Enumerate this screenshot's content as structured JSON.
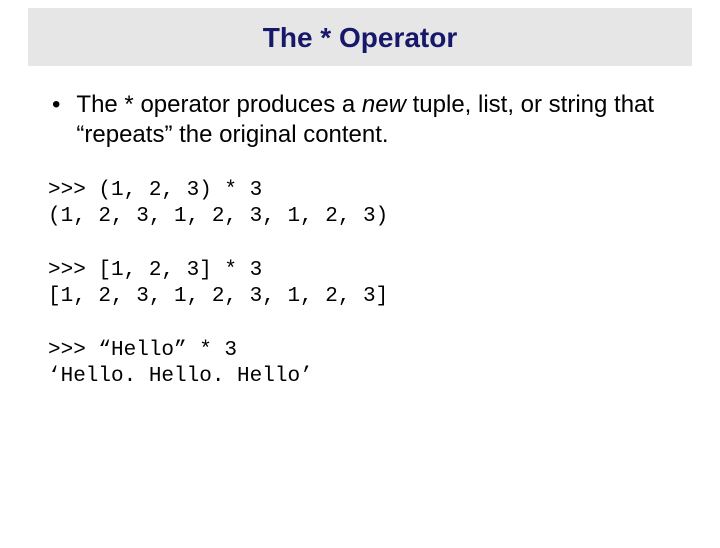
{
  "title": "The * Operator",
  "bullet": {
    "pre": "The * operator produces a ",
    "em": "new",
    "post": " tuple, list, or string that “repeats” the original content."
  },
  "code1_line1": ">>> (1, 2, 3) * 3",
  "code1_line2": "(1, 2, 3, 1, 2, 3, 1, 2, 3)",
  "code2_line1": ">>> [1, 2, 3] * 3",
  "code2_line2": "[1, 2, 3, 1, 2, 3, 1, 2, 3]",
  "code3_line1": ">>> “Hello” * 3",
  "code3_line2": "‘Hello. Hello. Hello’"
}
